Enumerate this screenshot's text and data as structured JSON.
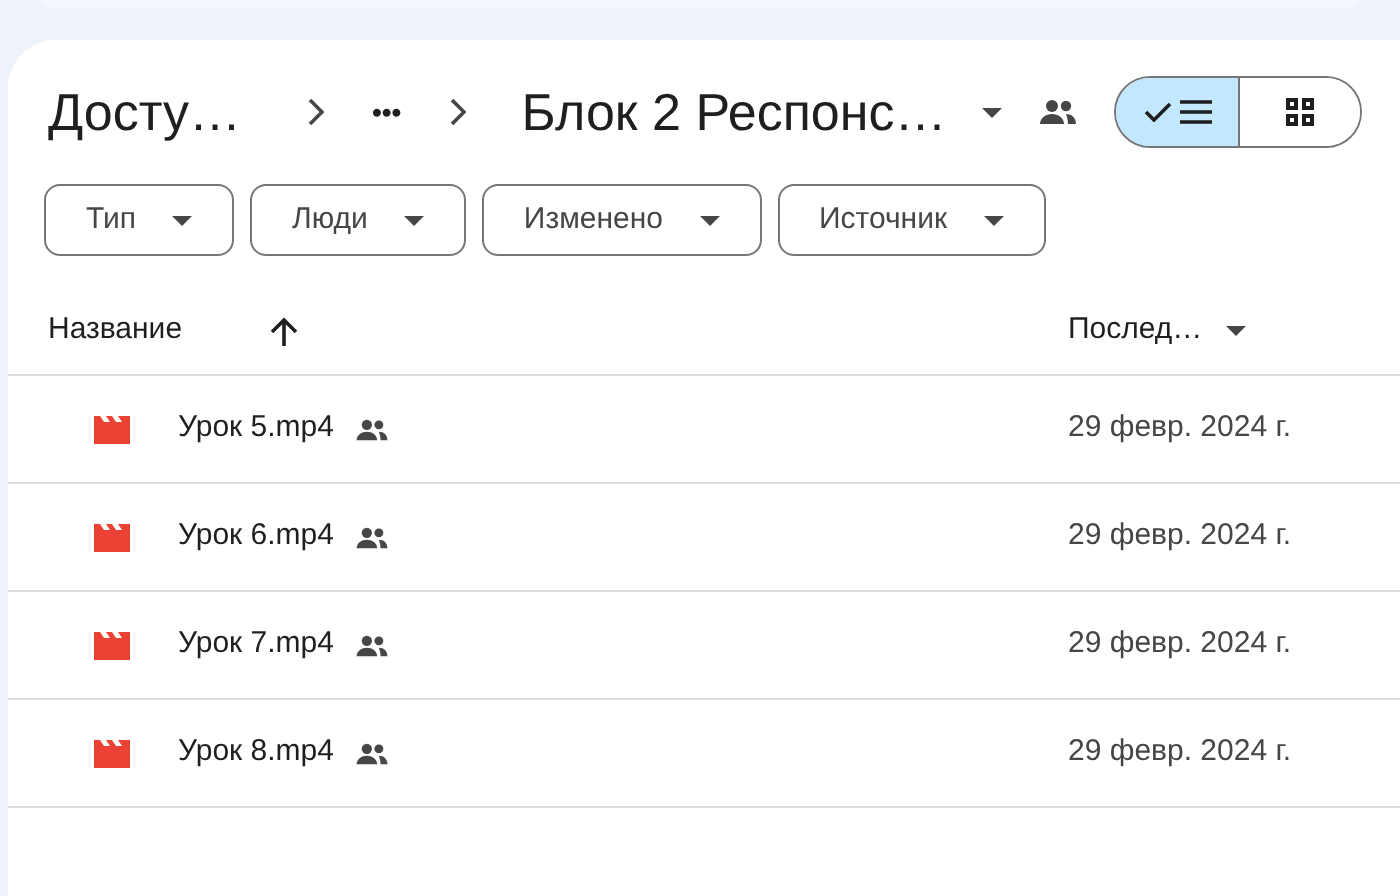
{
  "breadcrumb": {
    "root": "Досту…",
    "more": "•••",
    "current": "Блок 2 Респонс…"
  },
  "view_toggle": [
    {
      "kind": "list",
      "selected": true
    },
    {
      "kind": "grid",
      "selected": false
    }
  ],
  "filters": [
    "Тип",
    "Люди",
    "Изменено",
    "Источник"
  ],
  "table": {
    "columns": [
      {
        "label": "Название",
        "kind": "sorted"
      },
      {
        "label": "Послед…",
        "kind": "menu"
      }
    ],
    "rows": [
      {
        "name": "Урок 5.mp4",
        "shared": true,
        "date": "29 февр. 2024 г."
      },
      {
        "name": "Урок 6.mp4",
        "shared": true,
        "date": "29 февр. 2024 г."
      },
      {
        "name": "Урок 7.mp4",
        "shared": true,
        "date": "29 февр. 2024 г."
      },
      {
        "name": "Урок 8.mp4",
        "shared": true,
        "date": "29 февр. 2024 г."
      }
    ]
  }
}
